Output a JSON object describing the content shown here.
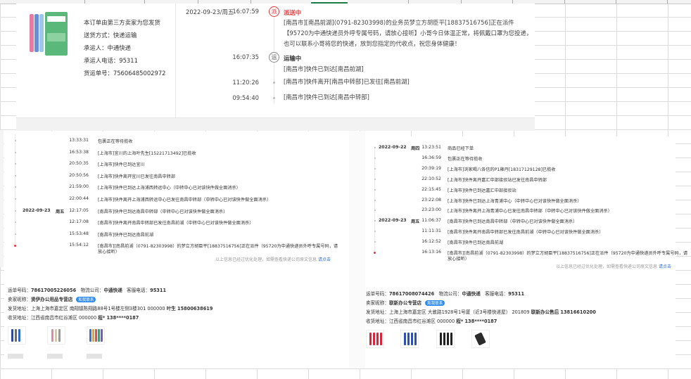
{
  "order_main": {
    "note": "本订单由第三方卖家为您发货",
    "delivery_method": "送货方式：快递运输",
    "carrier": "承运人：中通快递",
    "carrier_phone": "承运人电话：95311",
    "tracking_no": "货运单号：75606485002972",
    "timeline": [
      {
        "date": "2022-09-23/周五",
        "time": "16:07:59",
        "title": "派送中",
        "text": "[南昌市][南昌前湖](0791-82303998)的业务员梦立方胡臣平[18837516756]正在派件【95720为中通快递员外呼专属号码，请放心接听】小哥今日体温正常，将佩戴口罩为您投递，也可以联系小哥将您的快递，放到您指定的代收点，祝您身体健康！",
        "icon_text": "派"
      },
      {
        "date": "",
        "time": "16:07:35",
        "title": "运输中",
        "text": "[南昌市]快件已到达[南昌前湖]",
        "icon_text": "运"
      },
      {
        "date": "",
        "time": "11:20:26",
        "title": "",
        "text": "[南昌市]快件离开[南昌中转部]已发往[南昌前湖]",
        "icon_text": ""
      },
      {
        "date": "",
        "time": "09:54:40",
        "title": "",
        "text": "[南昌市]快件已到达[南昌中转部]",
        "icon_text": ""
      }
    ]
  },
  "card_left": {
    "events": [
      {
        "date": "",
        "weekday": "",
        "time": "13:33:31",
        "text": "包裹正在等待揽收"
      },
      {
        "date": "",
        "weekday": "",
        "time": "16:53:38",
        "text": "[上海市]宜川的上海叶先生[15221713492]已揽收"
      },
      {
        "date": "",
        "weekday": "",
        "time": "20:50:35",
        "text": "[上海市]快件已到达宜川"
      },
      {
        "date": "",
        "weekday": "",
        "time": "20:50:56",
        "text": "[上海市]快件离开宜川已发往南昌中转部"
      },
      {
        "date": "",
        "weekday": "",
        "time": "21:59:00",
        "text": "[上海市]快件已到达上海浦西转运中心（中转中心已对该快件做全面消杀）"
      },
      {
        "date": "",
        "weekday": "",
        "time": "22:00:44",
        "text": "[上海市]快件离开上海浦西转运中心已发往南昌中转部（中转中心已对该快件做全面消杀）"
      },
      {
        "date": "2022-09-23",
        "weekday": "周五",
        "time": "12:17:05",
        "text": "[南昌市]快件已到达南昌中转部（中转中心已对该快件做全面消杀）"
      },
      {
        "date": "",
        "weekday": "",
        "time": "12:17:08",
        "text": "[南昌市]快件离开南昌中转部已发往南昌前湖（中转中心已对该快件做全面消杀）"
      },
      {
        "date": "",
        "weekday": "",
        "time": "15:53:48",
        "text": "[南昌市]快件已到达南昌前湖"
      },
      {
        "date": "",
        "weekday": "",
        "time": "15:54:12",
        "text": "[南昌市][南昌前湖（0791-82303998）的梦立方胡臣平[18837516756]正在派件（95720为中通快递员外呼专属号码，请",
        "text2": "放心接听）"
      }
    ],
    "notice": "以上信息已经过优化处理，如需查看快递公司原文信息",
    "notice_link": "请点击",
    "waybill_label": "运单号码：",
    "waybill": "78617005226056",
    "logistics_label": "物流公司：",
    "logistics": "中通快递",
    "hotline_label": "客服电话：",
    "hotline": "95311",
    "seller_label": "卖家昵称：",
    "seller": "贤伊办公用品专营店",
    "contact": "和我联系",
    "from_label": "发货地址：",
    "from": "上海上海市嘉定区 南翔镇陈翔路88号1号楼左侧3楼301 000000",
    "from_name": "叶生",
    "from_phone": "15800638619",
    "to_label": "收货地址：",
    "to": "江西省南昌市红谷滩区 000000",
    "to_name": "程*",
    "to_phone": "138****0187"
  },
  "card_right": {
    "events": [
      {
        "date": "2022-09-22",
        "weekday": "周四",
        "time": "13:23:51",
        "text": "商品已经下单"
      },
      {
        "date": "",
        "weekday": "",
        "time": "16:36:59",
        "text": "包裹正在等待揽收"
      },
      {
        "date": "",
        "weekday": "",
        "time": "20:39:19",
        "text": "[上海市]浏家喝八各信的P1雍丹[18317129128]已揽收"
      },
      {
        "date": "",
        "weekday": "",
        "time": "22:10:52",
        "text": "[上海市]快件离开嘉汇中部接驳站已发往南昌中转部"
      },
      {
        "date": "",
        "weekday": "",
        "time": "22:15:45",
        "text": "[上海市]快件已到达嘉汇中部接驳站"
      },
      {
        "date": "",
        "weekday": "",
        "time": "23:22:08",
        "text": "[上海市]快件已到达上海青浦中心（中转中心已对该快件做全面消杀）"
      },
      {
        "date": "",
        "weekday": "",
        "time": "23:23:00",
        "text": "[上海市]快件离开上海青浦中心已发往南昌中转部（中转中心已对该快件做全面消杀）"
      },
      {
        "date": "2022-09-23",
        "weekday": "周五",
        "time": "11:06:37",
        "text": "[南昌市]快件已到达南昌中转部（中转中心已对该快件做全面消杀）"
      },
      {
        "date": "",
        "weekday": "",
        "time": "11:11:31",
        "text": "[南昌市]快件离开南昌中转部已发往南昌前湖（中转中心已对该快件做全面消杀）"
      },
      {
        "date": "",
        "weekday": "",
        "time": "16:12:52",
        "text": "[南昌市]快件已到达南昌前湖"
      },
      {
        "date": "",
        "weekday": "",
        "time": "16:13:16",
        "text": "[南昌市][南昌前湖（0791-82303998）的梦立方胡臣平[18837516756]正在派件（95720为中通快递员外呼专属号码，请",
        "text2": "放心接听）"
      }
    ],
    "notice": "以上信息已经过优化处理，如需查看快递公司原文信息",
    "notice_link": "请点击",
    "waybill_label": "运单号码：",
    "waybill": "78617008074426",
    "logistics_label": "物流公司：",
    "logistics": "中通快递",
    "hotline_label": "客服电话：",
    "hotline": "95311",
    "seller_label": "卖家昵称：",
    "seller": "联新办公专营店",
    "contact": "和我联系",
    "from_label": "发货地址：",
    "from": "上海上海市嘉定区 大敦路1928号1号厦（近3号楼快递屋） 201809",
    "from_name": "联新办公售后",
    "from_phone": "13816610200",
    "to_label": "收货地址：",
    "to": "江西省南昌市红谷滩区 000000",
    "to_name": "程*",
    "to_phone": "138****0187"
  }
}
